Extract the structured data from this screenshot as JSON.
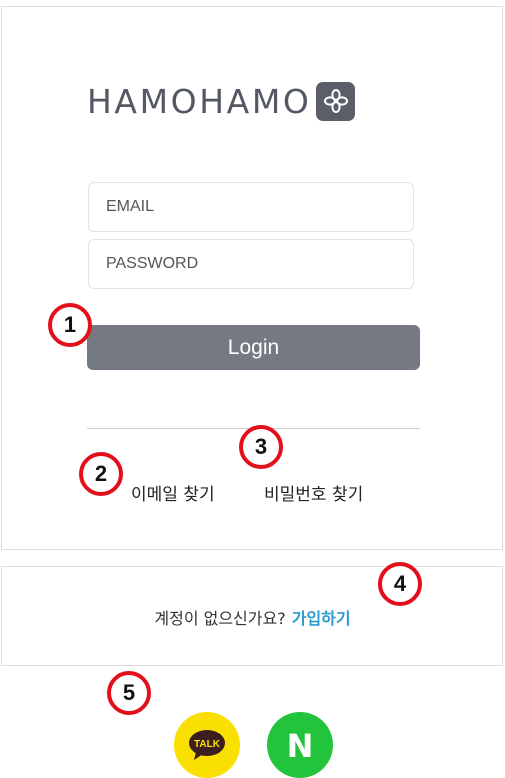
{
  "logo": {
    "text": "HAMOHAMO",
    "icon": "flower-icon"
  },
  "form": {
    "email_placeholder": "EMAIL",
    "password_placeholder": "PASSWORD",
    "login_label": "Login"
  },
  "links": {
    "find_email": "이메일 찾기",
    "find_password": "비밀번호 찾기"
  },
  "signup": {
    "question": "계정이 없으신가요?",
    "link": "가입하기"
  },
  "social": {
    "kakao_label": "TALK",
    "naver_label": "N"
  },
  "annotations": [
    "1",
    "2",
    "3",
    "4",
    "5"
  ],
  "colors": {
    "login_button": "#757a82",
    "signup_link": "#2a9bd0",
    "kakao": "#f9e000",
    "naver": "#22c43b",
    "annotation_ring": "#e3101b"
  }
}
